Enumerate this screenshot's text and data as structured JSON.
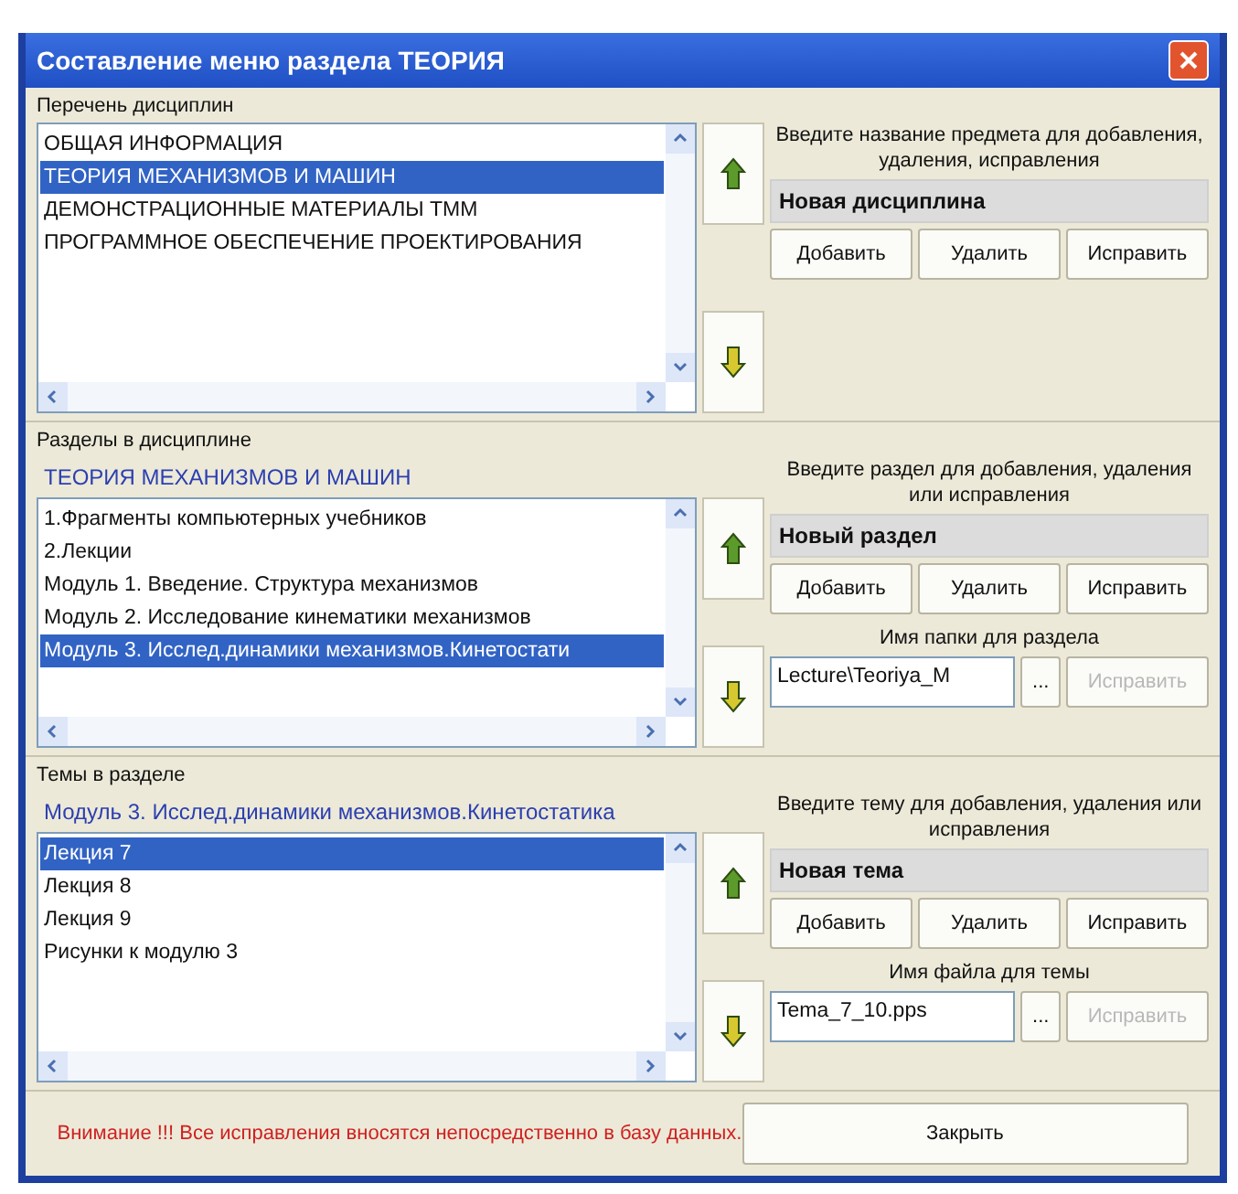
{
  "window": {
    "title": "Составление меню раздела ТЕОРИЯ"
  },
  "sections": [
    {
      "label": "Перечень дисциплин",
      "items": [
        {
          "text": "ОБЩАЯ ИНФОРМАЦИЯ",
          "selected": false
        },
        {
          "text": "ТЕОРИЯ МЕХАНИЗМОВ И МАШИН",
          "selected": true
        },
        {
          "text": "ДЕМОНСТРАЦИОННЫЕ МАТЕРИАЛЫ ТММ",
          "selected": false
        },
        {
          "text": "ПРОГРАММНОЕ ОБЕСПЕЧЕНИЕ ПРОЕКТИРОВАНИЯ",
          "selected": false
        }
      ],
      "prompt": "Введите название предмета для добавления, удаления, исправления",
      "value": "Новая дисциплина",
      "buttons": [
        "Добавить",
        "Удалить",
        "Исправить"
      ]
    },
    {
      "label": "Разделы в дисциплине",
      "heading": "ТЕОРИЯ МЕХАНИЗМОВ И МАШИН",
      "items": [
        {
          "text": "1.Фрагменты компьютерных учебников",
          "selected": false
        },
        {
          "text": "2.Лекции",
          "selected": false
        },
        {
          "text": "Модуль 1. Введение. Структура механизмов",
          "selected": false
        },
        {
          "text": "Модуль 2. Исследование кинематики механизмов",
          "selected": false
        },
        {
          "text": "Модуль 3. Исслед.динамики механизмов.Кинетостати",
          "selected": true
        }
      ],
      "prompt": "Введите раздел для добавления, удаления или исправления",
      "value": "Новый раздел",
      "buttons": [
        "Добавить",
        "Удалить",
        "Исправить"
      ],
      "path": {
        "label": "Имя папки для раздела",
        "value": "Lecture\\Teoriya_M",
        "browse": "...",
        "button": "Исправить",
        "disabled": true
      }
    },
    {
      "label": "Темы в разделе",
      "heading": "Модуль 3. Исслед.динамики механизмов.Кинетостатика",
      "items": [
        {
          "text": "Лекция 7",
          "selected": true
        },
        {
          "text": "Лекция 8",
          "selected": false
        },
        {
          "text": "Лекция 9",
          "selected": false
        },
        {
          "text": "Рисунки к модулю 3",
          "selected": false
        }
      ],
      "prompt": "Введите тему для добавления, удаления или исправления",
      "value": "Новая тема",
      "buttons": [
        "Добавить",
        "Удалить",
        "Исправить"
      ],
      "path": {
        "label": "Имя файла для темы",
        "value": "Tema_7_10.pps",
        "browse": "...",
        "button": "Исправить",
        "disabled": true
      }
    }
  ],
  "footer": {
    "warning": "Внимание !!! Все исправления вносятся непосредственно в базу данных.",
    "close": "Закрыть"
  }
}
